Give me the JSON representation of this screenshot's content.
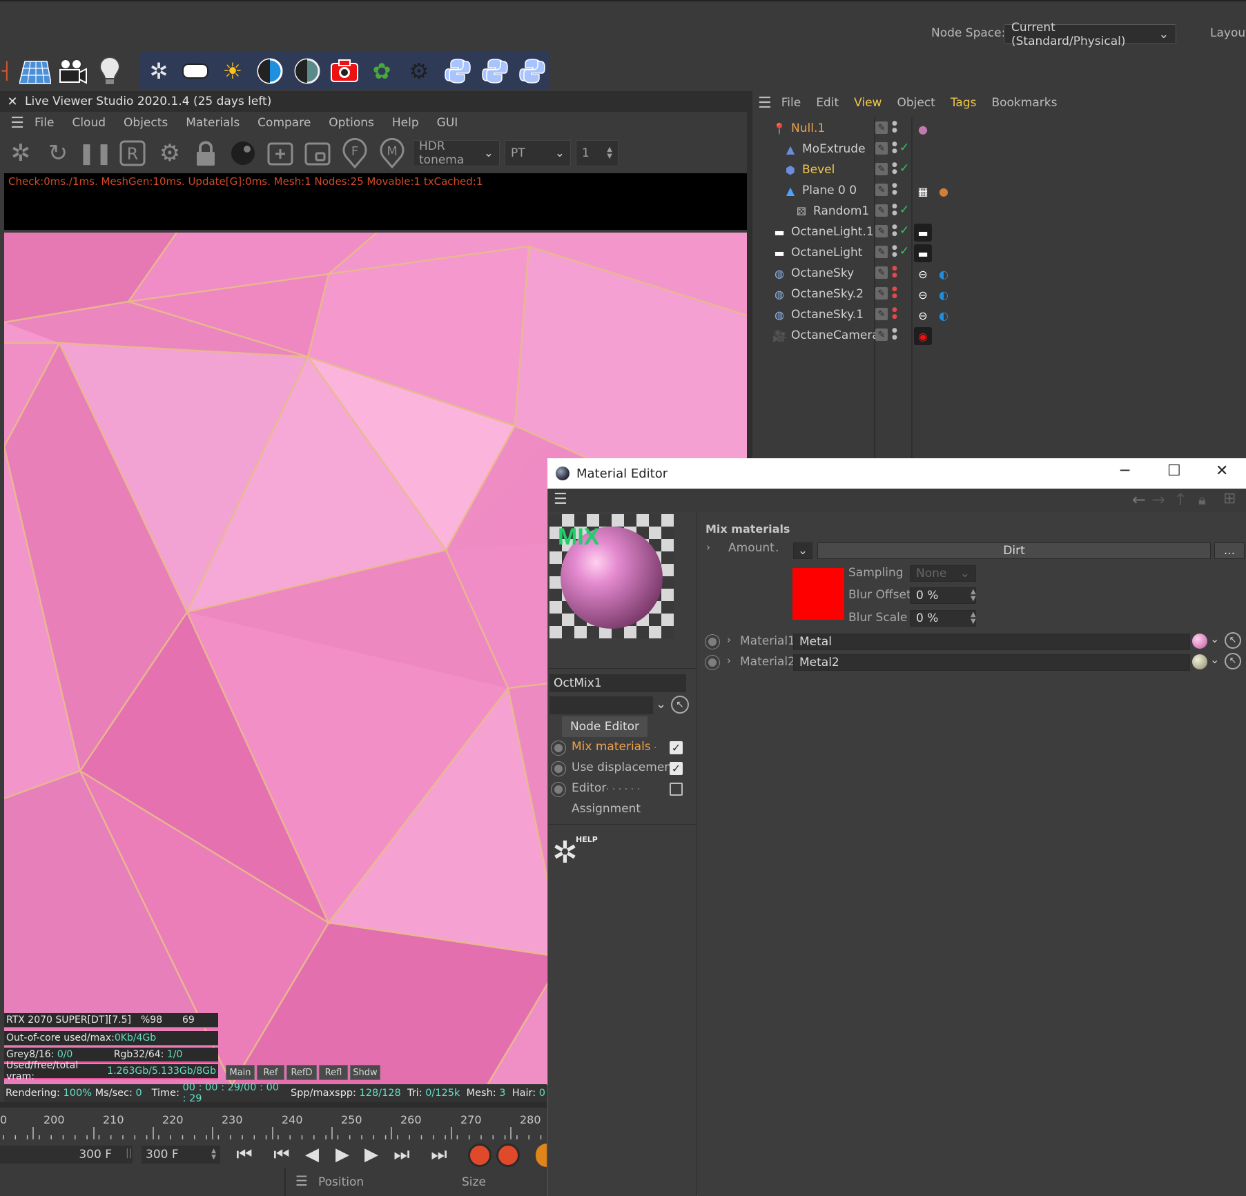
{
  "header": {
    "node_space_label": "Node Space:",
    "node_space_value": "Current (Standard/Physical)",
    "layout_label": "Layout"
  },
  "live_viewer": {
    "title": "Live Viewer Studio 2020.1.4 (25 days left)",
    "menu": [
      "File",
      "Cloud",
      "Objects",
      "Materials",
      "Compare",
      "Options",
      "Help",
      "GUI"
    ],
    "tonemap_select": "HDR tonema",
    "kernel_select": "PT",
    "spinner_value": "1",
    "console_text": "Check:0ms./1ms. MeshGen:10ms. Update[G]:0ms. Mesh:1 Nodes:25 Movable:1 txCached:1",
    "stats": {
      "gpu": "RTX 2070 SUPER[DT][7.5]",
      "gpu_pct": "%98",
      "gpu_temp": "69",
      "ooc_label": "Out-of-core used/max:",
      "ooc_value": "0Kb/4Gb",
      "grey_label": "Grey8/16:",
      "grey_value": "0/0",
      "rgb_label": "Rgb32/64:",
      "rgb_value": "1/0",
      "vram_label": "Used/free/total vram:",
      "vram_value": "1.263Gb/5.133Gb/8Gb"
    },
    "passes": [
      "Main",
      "Ref",
      "RefD",
      "Refl",
      "Shdw"
    ],
    "status": {
      "rendering_label": "Rendering:",
      "rendering_value": "100%",
      "mssec_label": "Ms/sec:",
      "mssec_value": "0",
      "time_label": "Time:",
      "time_value": "00 : 00 : 29/00 : 00 : 29",
      "spp_label": "Spp/maxspp:",
      "spp_value": "128/128",
      "tri_label": "Tri:",
      "tri_value": "0/125k",
      "mesh_label": "Mesh:",
      "mesh_value": "3",
      "hair_label": "Hair:",
      "hair_value": "0"
    }
  },
  "timeline": {
    "ticks": [
      "0",
      "200",
      "210",
      "220",
      "230",
      "240",
      "250",
      "260",
      "270",
      "280"
    ],
    "end_frame": "300 F",
    "max_frame": "300 F",
    "bottom_position": "Position",
    "bottom_size": "Size"
  },
  "object_manager": {
    "menu": [
      "File",
      "Edit",
      "View",
      "Object",
      "Tags",
      "Bookmarks"
    ],
    "objects": [
      {
        "name": "Null.1",
        "color": "#f0a14a"
      },
      {
        "name": "MoExtrude",
        "color": "#cfcfcf"
      },
      {
        "name": "Bevel",
        "color": "#f0c84a"
      },
      {
        "name": "Plane 0 0",
        "color": "#cfcfcf"
      },
      {
        "name": "Random1",
        "color": "#cfcfcf"
      },
      {
        "name": "OctaneLight.1",
        "color": "#cfcfcf"
      },
      {
        "name": "OctaneLight",
        "color": "#cfcfcf"
      },
      {
        "name": "OctaneSky",
        "color": "#cfcfcf"
      },
      {
        "name": "OctaneSky.2",
        "color": "#cfcfcf"
      },
      {
        "name": "OctaneSky.1",
        "color": "#cfcfcf"
      },
      {
        "name": "OctaneCamera",
        "color": "#cfcfcf"
      }
    ]
  },
  "material_editor": {
    "title": "Material Editor",
    "preview_badge": "MIX",
    "material_name": "OctMix1",
    "node_editor_button": "Node Editor",
    "channels": [
      {
        "label": "Mix materials",
        "suffix": ". .",
        "checked": true
      },
      {
        "label": "Use displacement",
        "suffix": "",
        "checked": true
      },
      {
        "label": "Editor",
        "suffix": ". . . . . .",
        "checked": false
      }
    ],
    "assignment": "Assignment",
    "help_badge": "HELP",
    "section_title": "Mix materials",
    "amount_label": "Amount",
    "amount_dots": ".",
    "amount_texture": "Dirt",
    "more_button": "...",
    "sampling_label": "Sampling",
    "sampling_value": "None",
    "blur_offset_label": "Blur Offset",
    "blur_offset_value": "0 %",
    "blur_scale_label": "Blur Scale",
    "blur_scale_value": "0 %",
    "swatch_color": "#ff0000",
    "material1_label": "Material1",
    "material1_value": "Metal",
    "material2_label": "Material2",
    "material2_value": "Metal2"
  }
}
